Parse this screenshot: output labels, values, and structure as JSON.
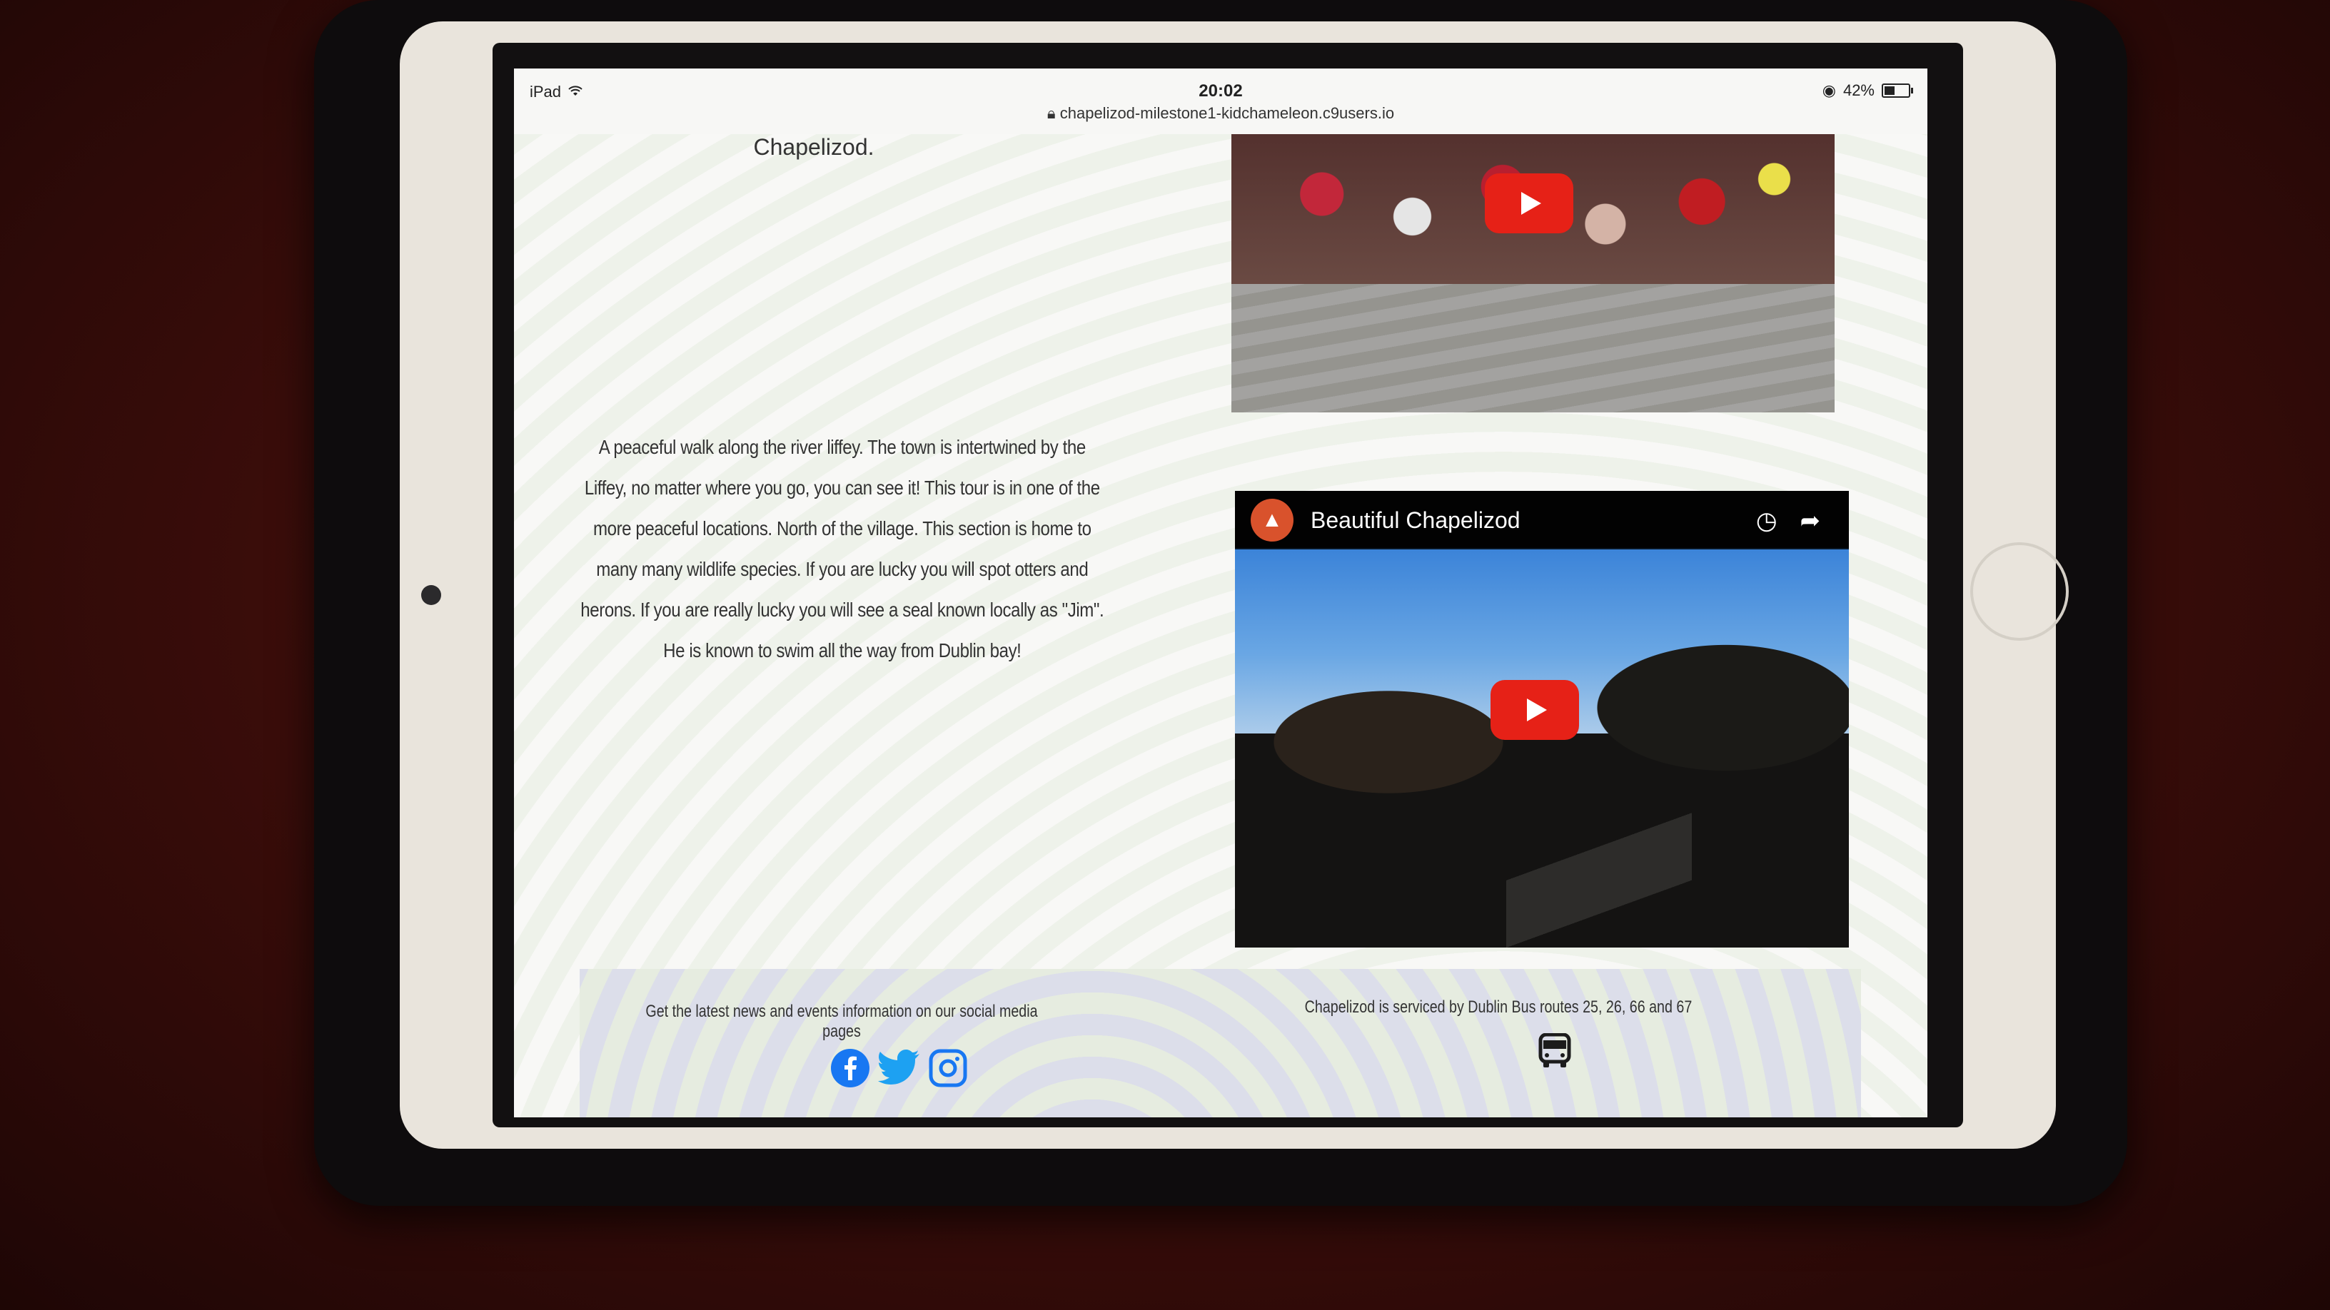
{
  "status_bar": {
    "device": "iPad",
    "time": "20:02",
    "url": "chapelizod-milestone1-kidchameleon.c9users.io",
    "battery": "42%"
  },
  "content": {
    "top_caption": "Chapelizod.",
    "description": "A peaceful walk along the river liffey. The town is intertwined by the Liffey, no matter where you go, you can see it! This tour is in one of the more peaceful locations. North of the village. This section is home to many many wildlife species. If you are lucky you will spot otters and herons. If you are really lucky you will see a seal known locally as \"Jim\". He is known to swim all the way from Dublin bay!"
  },
  "videos": [
    {
      "title": ""
    },
    {
      "title": "Beautiful Chapelizod"
    }
  ],
  "footer": {
    "social_text": "Get the latest news and events information on our social media pages",
    "bus_text": "Chapelizod is serviced by Dublin Bus routes 25, 26, 66 and 67",
    "icons": [
      "facebook-icon",
      "twitter-icon",
      "instagram-icon",
      "bus-icon"
    ],
    "colors": {
      "facebook": "#1877f2",
      "twitter": "#1da1f2",
      "instagram": "#1877f2"
    }
  }
}
